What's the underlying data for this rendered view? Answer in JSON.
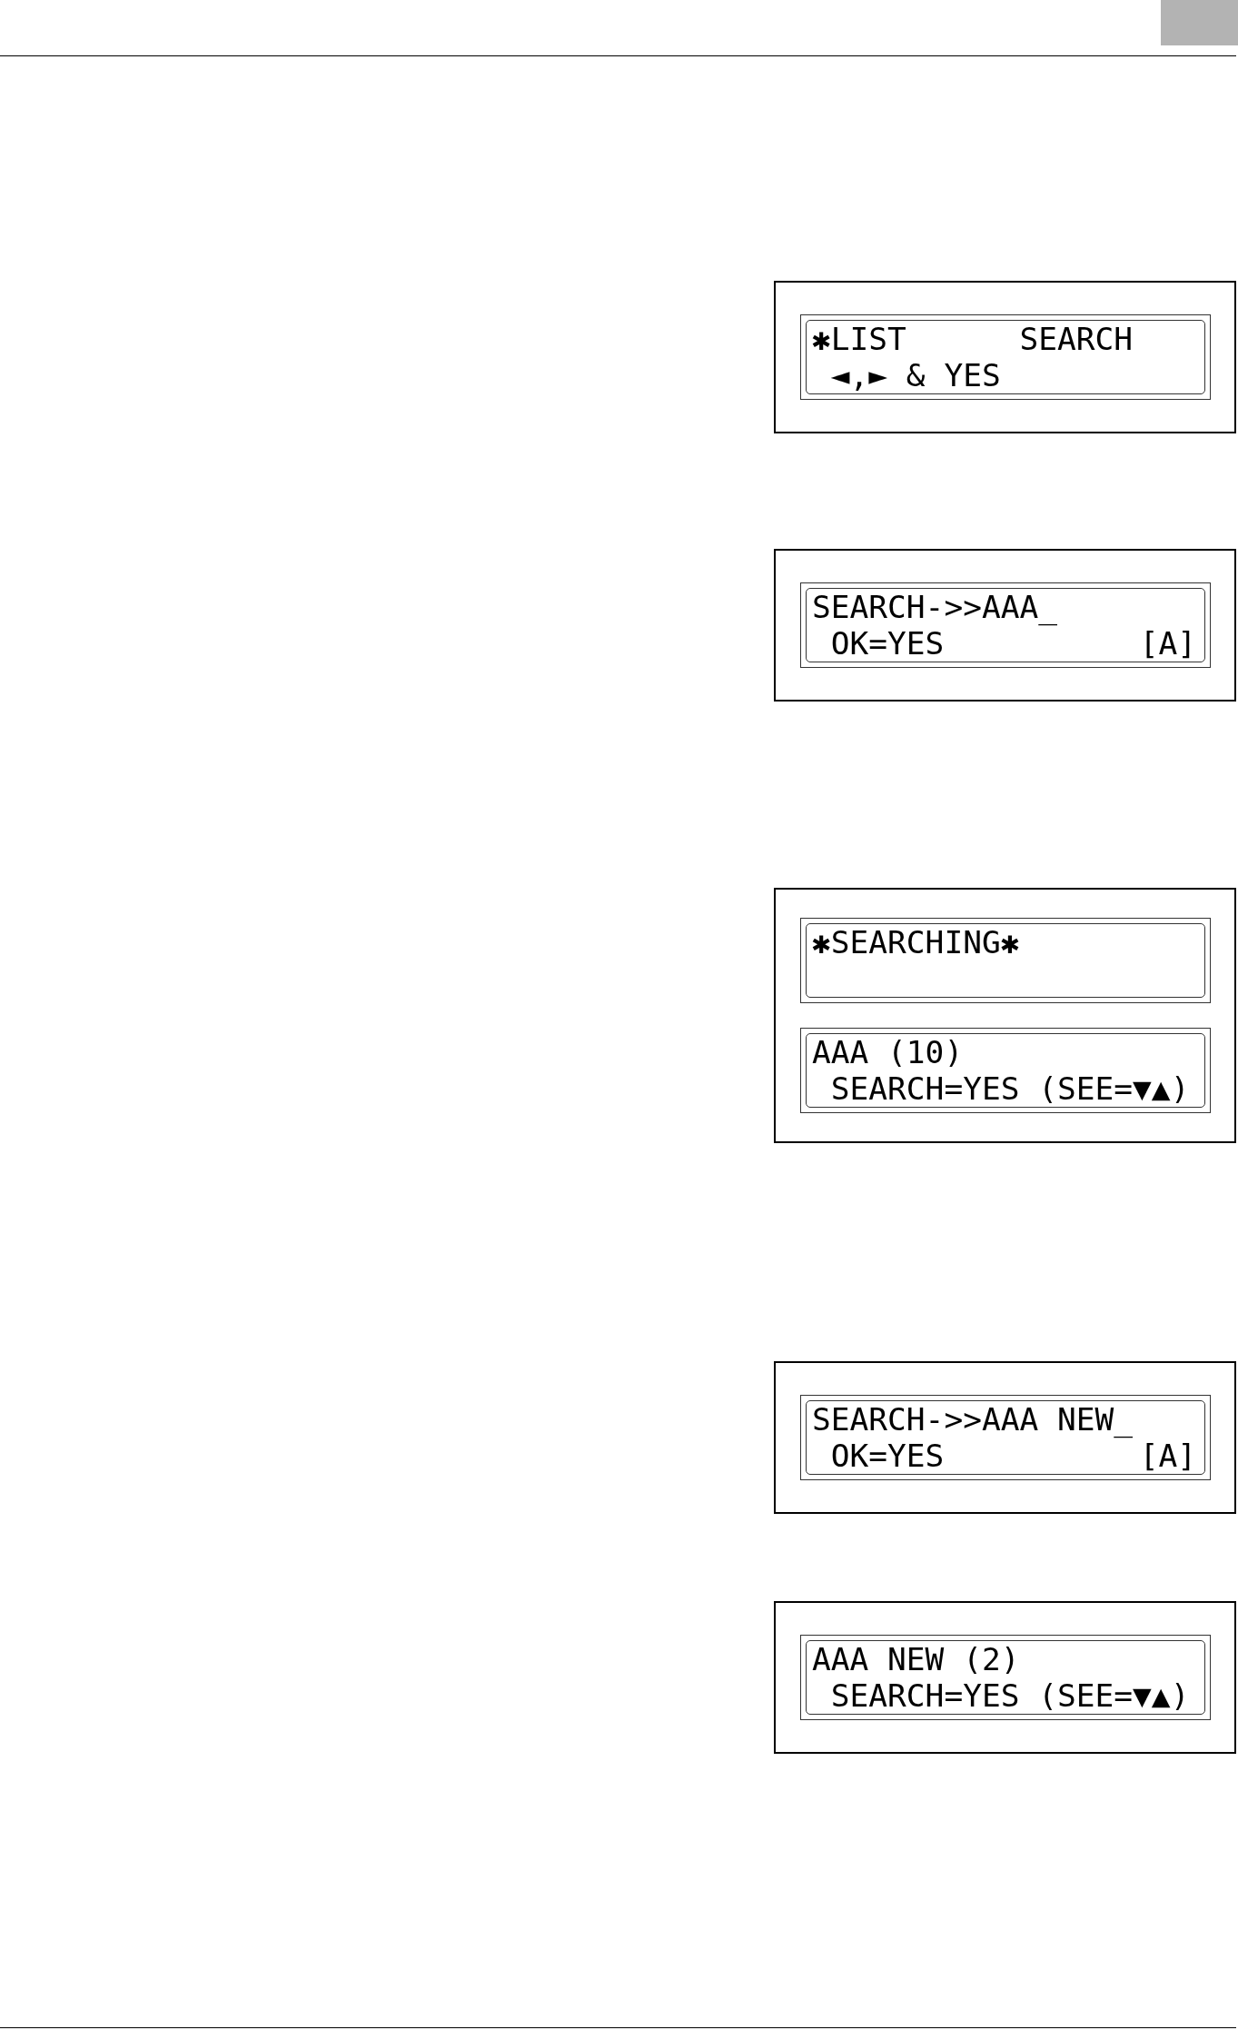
{
  "displays": [
    {
      "screens": [
        {
          "lines": [
            {
              "text": "✱LIST      SEARCH"
            },
            {
              "text": "◄,► & YES"
            }
          ]
        }
      ]
    },
    {
      "screens": [
        {
          "lines": [
            {
              "text": "SEARCH->>AAA_"
            },
            {
              "text": "OK=YES",
              "indicator": "[A]"
            }
          ]
        }
      ]
    },
    {
      "screens": [
        {
          "lines": [
            {
              "text": "✱SEARCHING✱"
            }
          ]
        },
        {
          "lines": [
            {
              "text": "AAA (10)"
            },
            {
              "text": "SEARCH=YES (SEE=▼▲)"
            }
          ]
        }
      ]
    },
    {
      "screens": [
        {
          "lines": [
            {
              "text": "SEARCH->>AAA NEW_"
            },
            {
              "text": "OK=YES",
              "indicator": "[A]"
            }
          ]
        }
      ]
    },
    {
      "screens": [
        {
          "lines": [
            {
              "text": "AAA NEW (2)"
            },
            {
              "text": "SEARCH=YES (SEE=▼▲)"
            }
          ]
        }
      ]
    }
  ]
}
